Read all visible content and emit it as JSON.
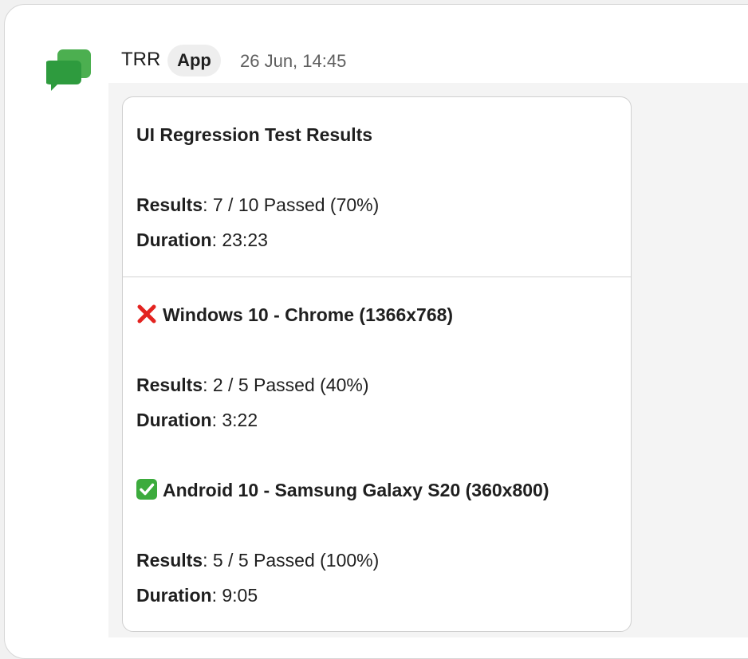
{
  "message": {
    "sender": "TRR",
    "badge": "App",
    "timestamp": "26 Jun, 14:45",
    "avatar_icon": "google-chat-icon"
  },
  "card": {
    "title": "UI Regression Test Results",
    "summary": {
      "results_label": "Results",
      "results_value": ": 7 / 10 Passed (70%)",
      "duration_label": "Duration",
      "duration_value": ": 23:23"
    },
    "sections": [
      {
        "status_icon": "cross-mark-icon",
        "status_color": "#e32320",
        "heading": "Windows 10 - Chrome (1366x768)",
        "results_label": "Results",
        "results_value": ": 2 / 5 Passed (40%)",
        "duration_label": "Duration",
        "duration_value": ": 3:22"
      },
      {
        "status_icon": "check-mark-button-icon",
        "status_color": "#3cab3d",
        "heading": "Android 10 - Samsung Galaxy S20 (360x800)",
        "results_label": "Results",
        "results_value": ": 5 / 5 Passed (100%)",
        "duration_label": "Duration",
        "duration_value": ": 9:05"
      }
    ]
  }
}
